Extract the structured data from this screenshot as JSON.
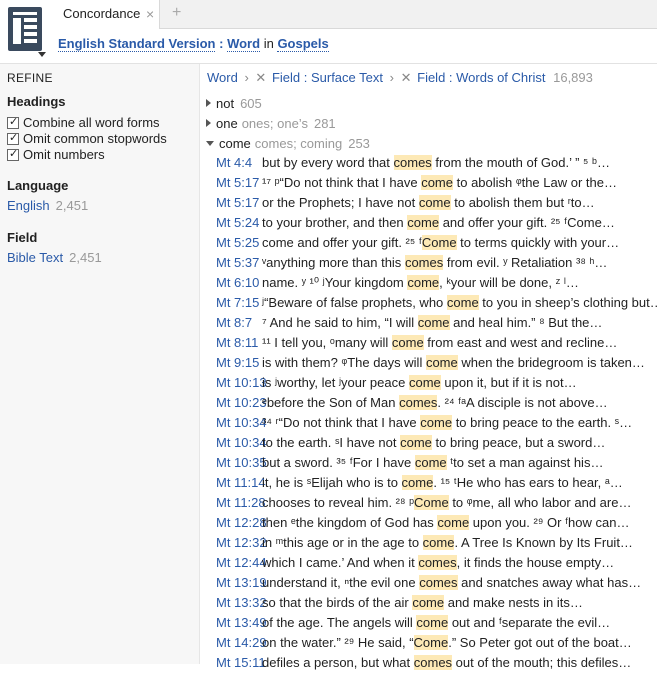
{
  "tab": {
    "label": "Concordance",
    "close": "×",
    "add": "+"
  },
  "resource": {
    "version": "English Standard Version",
    "colon": ":",
    "field": "Word",
    "in": "in",
    "scope": "Gospels"
  },
  "refine": {
    "title": "REFINE",
    "headings": {
      "title": "Headings",
      "options": [
        {
          "label": "Combine all word forms",
          "checked": true
        },
        {
          "label": "Omit common stopwords",
          "checked": true
        },
        {
          "label": "Omit numbers",
          "checked": true
        }
      ]
    },
    "language": {
      "title": "Language",
      "value": "English",
      "count": "2,451"
    },
    "field": {
      "title": "Field",
      "value": "Bible Text",
      "count": "2,451"
    }
  },
  "crumbs": {
    "root": "Word",
    "arrow": "›",
    "remove": "✕",
    "c1": "Field : Surface Text",
    "c2": "Field : Words of Christ",
    "count": "16,893"
  },
  "groups": [
    {
      "word": "not",
      "forms": "",
      "count": "605",
      "expanded": false
    },
    {
      "word": "one",
      "forms": "ones; one’s",
      "count": "281",
      "expanded": false
    },
    {
      "word": "come",
      "forms": "comes; coming",
      "count": "253",
      "expanded": true
    }
  ],
  "rows": [
    {
      "ref": "Mt 4:4",
      "pre": "but by every word that ",
      "hit": "comes",
      "post": " from the mouth of God.’ ” ⁵ ᵇ…"
    },
    {
      "ref": "Mt 5:17",
      "pre": "¹⁷ ᵖ“Do not think that I have ",
      "hit": "come",
      "post": " to abolish ᵠthe Law or the…"
    },
    {
      "ref": "Mt 5:17",
      "pre": "or the Prophets; I have not ",
      "hit": "come",
      "post": " to abolish them but ʳto…"
    },
    {
      "ref": "Mt 5:24",
      "pre": "to your brother, and then ",
      "hit": "come",
      "post": " and offer your gift. ²⁵ ᶠCome…"
    },
    {
      "ref": "Mt 5:25",
      "pre": "come and offer your gift. ²⁵ ᶠ",
      "hit": "Come",
      "post": " to terms quickly with your…"
    },
    {
      "ref": "Mt 5:37",
      "pre": "ᵛanything more than this ",
      "hit": "comes",
      "post": " from evil. ʸ Retaliation ³⁸ ʰ…"
    },
    {
      "ref": "Mt 6:10",
      "pre": "name. ʸ    ¹⁰    ʲYour kingdom ",
      "hit": "come",
      "post": ",      ᵏyour will be done, ᶻ ˡ…"
    },
    {
      "ref": "Mt 7:15",
      "pre": "ʲ“Beware of false prophets, who ",
      "hit": "come",
      "post": " to you in sheep’s clothing but…"
    },
    {
      "ref": "Mt 8:7",
      "pre": "⁷ And he said to him, “I will ",
      "hit": "come",
      "post": " and heal him.” ⁸ But the…"
    },
    {
      "ref": "Mt 8:11",
      "pre": "¹¹ I tell you, ᵒmany will ",
      "hit": "come",
      "post": " from east and west and recline…"
    },
    {
      "ref": "Mt 9:15",
      "pre": "is with them? ᵠThe days will ",
      "hit": "come",
      "post": " when the bridegroom is taken…"
    },
    {
      "ref": "Mt 10:13",
      "pre": "is ʲworthy, let ʲyour peace ",
      "hit": "come",
      "post": " upon it, but if it is not…"
    },
    {
      "ref": "Mt 10:23",
      "pre": "ᵉbefore the Son of Man ",
      "hit": "comes",
      "post": ". ²⁴ ᶠᵃA disciple is not above…"
    },
    {
      "ref": "Mt 10:34",
      "pre": "³⁴ ʳ“Do not think that I have ",
      "hit": "come",
      "post": " to bring peace to the earth. ˢ…"
    },
    {
      "ref": "Mt 10:34",
      "pre": "to the earth. ˢI have not ",
      "hit": "come",
      "post": " to bring peace, but a sword…"
    },
    {
      "ref": "Mt 10:35",
      "pre": "but a sword. ³⁵ ᶠFor I have ",
      "hit": "come",
      "post": " ᵗto set a man against his…"
    },
    {
      "ref": "Mt 11:14",
      "pre": "it, he is ˢElijah who is to ",
      "hit": "come",
      "post": ". ¹⁵ ᵗHe who has ears to hear, ᵃ…"
    },
    {
      "ref": "Mt 11:28",
      "pre": "chooses to reveal him. ²⁸ ᵖ",
      "hit": "Come",
      "post": " to ᵠme, all who labor and are…"
    },
    {
      "ref": "Mt 12:28",
      "pre": "then ᵉthe kingdom of God has ",
      "hit": "come",
      "post": " upon you. ²⁹ Or ᶠhow can…"
    },
    {
      "ref": "Mt 12:32",
      "pre": "in ᵐthis age or in the age to ",
      "hit": "come",
      "post": ". A Tree Is Known by Its Fruit…"
    },
    {
      "ref": "Mt 12:44",
      "pre": "which I came.’ And when it ",
      "hit": "comes",
      "post": ", it finds the house empty…"
    },
    {
      "ref": "Mt 13:19",
      "pre": "understand it, ⁿthe evil one ",
      "hit": "comes",
      "post": " and snatches away what has…"
    },
    {
      "ref": "Mt 13:32",
      "pre": "so that the birds of the air ",
      "hit": "come",
      "post": " and make nests in its…"
    },
    {
      "ref": "Mt 13:49",
      "pre": "of the age. The angels will ",
      "hit": "come",
      "post": " out and ᶠseparate the evil…"
    },
    {
      "ref": "Mt 14:29",
      "pre": "on the water.” ²⁹ He said, “",
      "hit": "Come",
      "post": ".” So Peter got out of the boat…"
    },
    {
      "ref": "Mt 15:11",
      "pre": "defiles a person, but what ",
      "hit": "comes",
      "post": " out of the mouth; this defiles…"
    }
  ]
}
